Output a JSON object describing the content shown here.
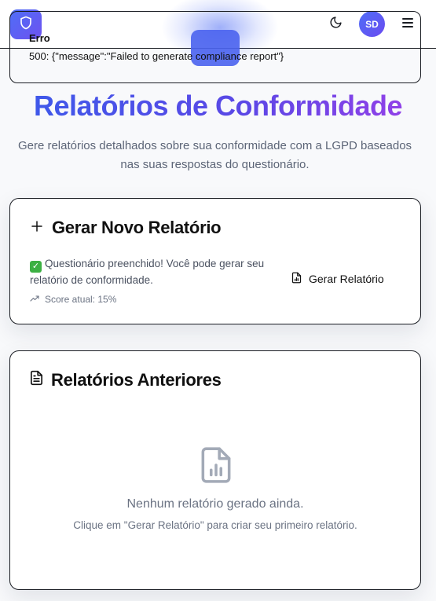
{
  "header": {
    "avatar_initials": "SD",
    "logo_icon": "shield-icon",
    "theme_icon": "moon-icon",
    "menu_icon": "hamburger-menu-icon",
    "accent_color": "#4f6ef7"
  },
  "error": {
    "title": "Erro",
    "message": "500: {\"message\":\"Failed to generate compliance report\"}"
  },
  "page": {
    "title": "Relatórios de Conformidade",
    "subtitle": "Gere relatórios detalhados sobre sua conformidade com a LGPD baseados nas suas respostas do questionário."
  },
  "generate_card": {
    "title": "Gerar Novo Relatório",
    "title_icon": "plus-icon",
    "status_text": "Questionário preenchido! Você pode gerar seu relatório de conformidade.",
    "status_icon": "check-mark-icon",
    "score_label": "Score atual: 15%",
    "score_icon": "trending-up-icon",
    "button_label": "Gerar Relatório",
    "button_icon": "file-chart-icon"
  },
  "previous_card": {
    "title": "Relatórios Anteriores",
    "title_icon": "file-text-icon",
    "empty_icon": "file-chart-icon",
    "empty_title": "Nenhum relatório gerado ainda.",
    "empty_subtitle": "Clique em \"Gerar Relatório\" para criar seu primeiro relatório."
  }
}
